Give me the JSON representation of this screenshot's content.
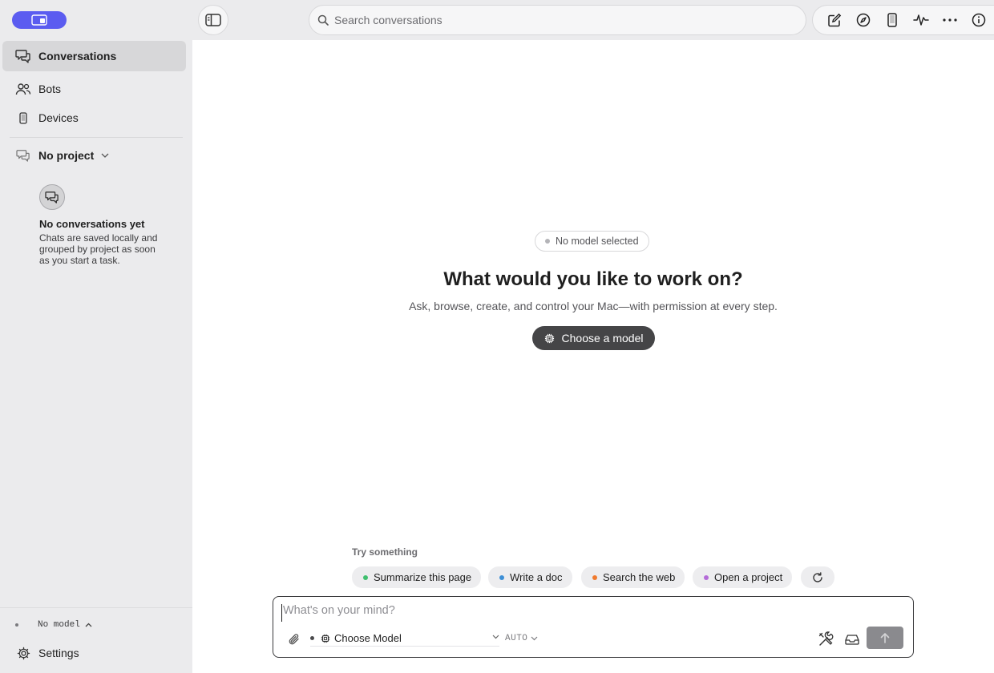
{
  "topbar": {
    "search_placeholder": "Search conversations",
    "app_badge_icon": "app-window-icon",
    "tools": [
      "new-chat-icon",
      "compass-icon",
      "phone-icon",
      "activity-icon",
      "more-icon",
      "info-icon"
    ]
  },
  "sidebar": {
    "items": [
      {
        "label": "Conversations",
        "icon": "chat-bubbles-icon",
        "active": true
      },
      {
        "label": "Bots",
        "icon": "people-icon",
        "active": false
      },
      {
        "label": "Devices",
        "icon": "phone-icon",
        "active": false
      }
    ],
    "project_label": "No project",
    "empty_title": "No conversations yet",
    "empty_desc": "Chats are saved locally and grouped by project as soon as you start a task.",
    "model_status": "No model",
    "settings_label": "Settings"
  },
  "main": {
    "model_pill": "No model selected",
    "headline": "What would you like to work on?",
    "subline": "Ask, browse, create, and control your Mac—with permission at every step.",
    "choose_button": "Choose a model",
    "try_label": "Try something",
    "suggestions": [
      {
        "label": "Summarize this page",
        "color": "#3fbf6e"
      },
      {
        "label": "Write a doc",
        "color": "#3d8fd6"
      },
      {
        "label": "Search the web",
        "color": "#f07a2e"
      },
      {
        "label": "Open a project",
        "color": "#b46bd8"
      }
    ]
  },
  "composer": {
    "placeholder": "What's on your mind?",
    "model_select": "Choose Model",
    "mode": "AUTO"
  },
  "colors": {
    "accent": "#5b5cf0",
    "sidebar_bg": "#ebebed",
    "main_bg": "#ffffff",
    "primary_button": "#454547",
    "send_button": "#8a8a8e"
  }
}
